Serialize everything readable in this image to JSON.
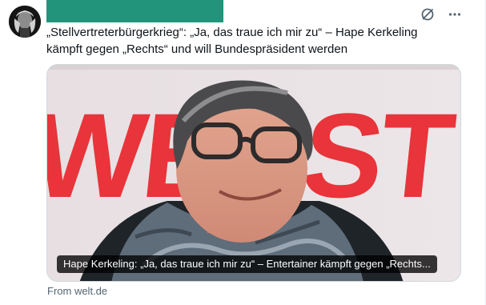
{
  "tweet": {
    "text_line1": "„Stellvertreterbürgerkrieg“: „Ja, das traue ich mir zu“ – Hape Kerkeling",
    "text_line2": "kämpft gegen „Rechts“ und will Bundespräsident werden"
  },
  "card": {
    "caption": "Hape Kerkeling: „Ja, das traue ich mir zu“ – Entertainer kämpft gegen „Rechts...",
    "backdrop_text": "WERST",
    "source": "From welt.de"
  },
  "icons": {
    "grok": "grok-icon",
    "more": "more-icon"
  },
  "colors": {
    "redaction": "#23947c",
    "backdrop_red": "#e8343a",
    "muted_text": "#536471"
  }
}
